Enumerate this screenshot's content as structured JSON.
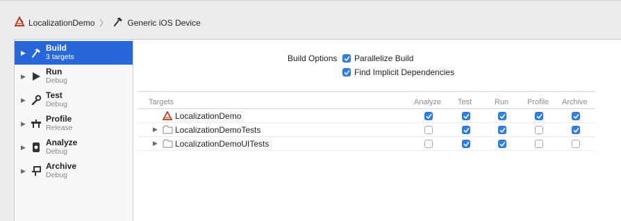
{
  "breadcrumb": {
    "project": "LocalizationDemo",
    "separator": "〉",
    "device": "Generic iOS Device"
  },
  "sidebar": {
    "actions": [
      {
        "title": "Build",
        "subtitle": "3 targets",
        "icon": "hammer-icon",
        "selected": true
      },
      {
        "title": "Run",
        "subtitle": "Debug",
        "icon": "play-icon",
        "selected": false
      },
      {
        "title": "Test",
        "subtitle": "Debug",
        "icon": "wrench-icon",
        "selected": false
      },
      {
        "title": "Profile",
        "subtitle": "Release",
        "icon": "instruments-icon",
        "selected": false
      },
      {
        "title": "Analyze",
        "subtitle": "Debug",
        "icon": "analyze-icon",
        "selected": false
      },
      {
        "title": "Archive",
        "subtitle": "Debug",
        "icon": "archive-icon",
        "selected": false
      }
    ]
  },
  "build_options": {
    "label": "Build Options",
    "parallelize": {
      "label": "Parallelize Build",
      "checked": true
    },
    "implicit": {
      "label": "Find Implicit Dependencies",
      "checked": true
    }
  },
  "targets": {
    "headers": {
      "name": "Targets",
      "analyze": "Analyze",
      "test": "Test",
      "run": "Run",
      "profile": "Profile",
      "archive": "Archive"
    },
    "rows": [
      {
        "name": "LocalizationDemo",
        "icon": "app-target-icon",
        "expandable": false,
        "analyze": true,
        "test": true,
        "run": true,
        "profile": true,
        "archive": true
      },
      {
        "name": "LocalizationDemoTests",
        "icon": "test-bundle-icon",
        "expandable": true,
        "analyze": false,
        "test": true,
        "run": true,
        "profile": false,
        "archive": true
      },
      {
        "name": "LocalizationDemoUITests",
        "icon": "test-bundle-icon",
        "expandable": true,
        "analyze": false,
        "test": true,
        "run": true,
        "profile": false,
        "archive": false
      }
    ]
  },
  "colors": {
    "accent": "#2767d9",
    "checkbox": "#2f7fe7"
  }
}
